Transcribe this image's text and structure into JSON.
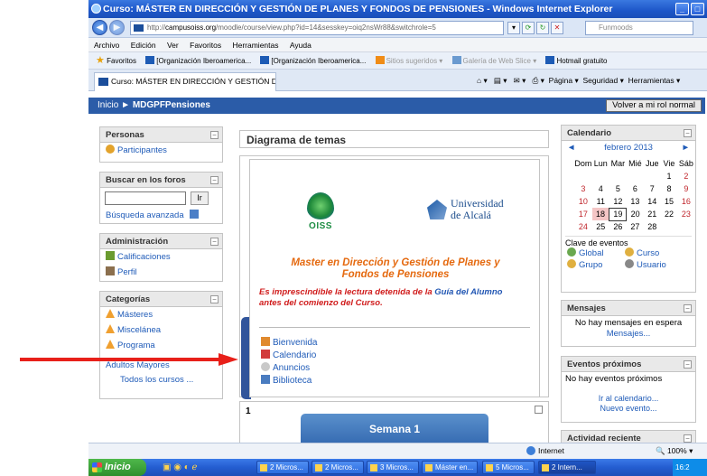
{
  "window": {
    "title": "Curso: MÁSTER EN DIRECCIÓN Y GESTIÓN DE PLANES Y FONDOS DE PENSIONES - Windows Internet Explorer"
  },
  "address": {
    "url_prefix": "http://",
    "url_host": "campusoiss.org",
    "url_rest": "/moodle/course/view.php?id=14&sesskey=oiq2nsWr88&switchrole=5",
    "search_placeholder": "Funmoods"
  },
  "menubar": [
    "Archivo",
    "Edición",
    "Ver",
    "Favoritos",
    "Herramientas",
    "Ayuda"
  ],
  "favorites": {
    "label": "Favoritos",
    "items": [
      "[Organización Iberoamerica...",
      "[Organización Iberoamerica...",
      "Sitios sugeridos ▾",
      "Galería de Web Slice ▾",
      "Hotmail gratuito"
    ]
  },
  "tab": {
    "label": "Curso: MÁSTER EN DIRECCIÓN Y GESTIÓN DE PLANE..."
  },
  "commandbar": {
    "pagina": "Página ▾",
    "seguridad": "Seguridad ▾",
    "herramientas": "Herramientas ▾"
  },
  "navbar": {
    "home": "Inicio",
    "separator": "►",
    "course": "MDGPFPensiones",
    "role_button": "Volver a mi rol normal"
  },
  "left": {
    "personas": {
      "title": "Personas",
      "items": [
        "Participantes"
      ]
    },
    "buscar": {
      "title": "Buscar en los foros",
      "go": "Ir",
      "advanced": "Búsqueda avanzada"
    },
    "admin": {
      "title": "Administración",
      "items": [
        "Calificaciones",
        "Perfil"
      ]
    },
    "categorias": {
      "title": "Categorías",
      "items": [
        "Másteres",
        "Miscelánea",
        "Programa",
        "Adultos Mayores"
      ],
      "all": "Todos los cursos ..."
    }
  },
  "center": {
    "heading": "Diagrama de temas",
    "oiss_label": "OISS",
    "uah_line1": "Universidad",
    "uah_line2": "de Alcalá",
    "title_line1": "Master en Dirección y Gestión de Planes y",
    "title_line2": "Fondos de Pensiones",
    "note_part1": "Es imprescindible la lectura detenida de la ",
    "note_link": "Guía del Alumno",
    "note_part2": "antes del comienzo del Curso.",
    "resources": [
      "Bienvenida",
      "Calendario",
      "Anuncios",
      "Biblioteca"
    ],
    "section_number": "1",
    "week_label": "Semana 1"
  },
  "right": {
    "calendar": {
      "title": "Calendario",
      "month": "febrero 2013",
      "prev": "◄",
      "next": "►",
      "weekdays": [
        "Dom",
        "Lun",
        "Mar",
        "Mié",
        "Jue",
        "Vie",
        "Sáb"
      ],
      "weeks": [
        [
          "",
          "",
          "",
          "",
          "",
          "1",
          "2"
        ],
        [
          "3",
          "4",
          "5",
          "6",
          "7",
          "8",
          "9"
        ],
        [
          "10",
          "11",
          "12",
          "13",
          "14",
          "15",
          "16"
        ],
        [
          "17",
          "18",
          "19",
          "20",
          "21",
          "22",
          "23"
        ],
        [
          "24",
          "25",
          "26",
          "27",
          "28",
          "",
          ""
        ]
      ],
      "events_key": "Clave de eventos",
      "keys": [
        "Global",
        "Curso",
        "Grupo",
        "Usuario"
      ]
    },
    "mensajes": {
      "title": "Mensajes",
      "text": "No hay mensajes en espera",
      "link": "Mensajes..."
    },
    "eventos": {
      "title": "Eventos próximos",
      "text": "No hay eventos próximos",
      "link1": "Ir al calendario...",
      "link2": "Nuevo evento..."
    },
    "actividad": {
      "title": "Actividad reciente"
    }
  },
  "statusbar": {
    "zone": "Internet",
    "zoom": "100%"
  },
  "taskbar": {
    "start": "Inicio",
    "buttons": [
      "2 Micros...",
      "2 Micros...",
      "3 Micros...",
      "Máster en...",
      "5 Micros...",
      "2 Intern..."
    ],
    "clock": "16:2"
  },
  "colors": {
    "moodle_nav": "#2b5ca8",
    "link": "#1f5bb8",
    "title_orange": "#e56a10",
    "note_red": "#d01c1c",
    "arrow": "#e8201a"
  }
}
